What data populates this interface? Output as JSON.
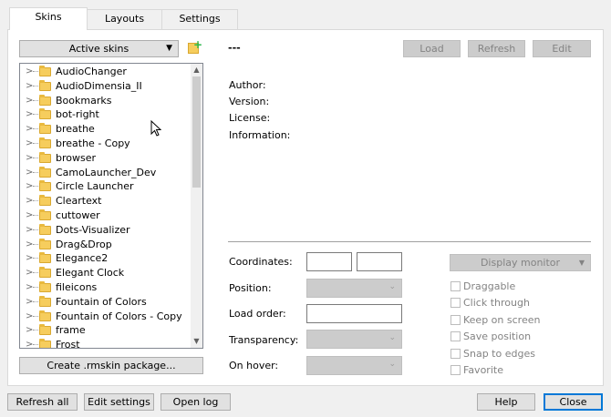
{
  "tabs": [
    "Skins",
    "Layouts",
    "Settings"
  ],
  "skins_dropdown": "Active skins",
  "skins": [
    "AudioChanger",
    "AudioDimensia_II",
    "Bookmarks",
    "bot-right",
    "breathe",
    "breathe - Copy",
    "browser",
    "CamoLauncher_Dev",
    "Circle Launcher",
    "Cleartext",
    "cuttower",
    "Dots-Visualizer",
    "Drag&Drop",
    "Elegance2",
    "Elegant Clock",
    "fileicons",
    "Fountain of Colors",
    "Fountain of Colors - Copy",
    "frame",
    "Frost"
  ],
  "create_package": "Create .rmskin package...",
  "skin_name": "---",
  "actions": {
    "load": "Load",
    "refresh": "Refresh",
    "edit": "Edit"
  },
  "info": {
    "author": "Author:",
    "version": "Version:",
    "license": "License:",
    "information": "Information:"
  },
  "props": {
    "coordinates": "Coordinates:",
    "position": "Position:",
    "load_order": "Load order:",
    "transparency": "Transparency:",
    "on_hover": "On hover:"
  },
  "display_monitor": "Display monitor",
  "options": [
    "Draggable",
    "Click through",
    "Keep on screen",
    "Save position",
    "Snap to edges",
    "Favorite"
  ],
  "footer": {
    "refresh_all": "Refresh all",
    "edit_settings": "Edit settings",
    "open_log": "Open log",
    "help": "Help",
    "close": "Close"
  },
  "colors": {
    "accent": "#0078d7",
    "folder": "#f6cd5d",
    "add_icon": "#2db84b"
  }
}
